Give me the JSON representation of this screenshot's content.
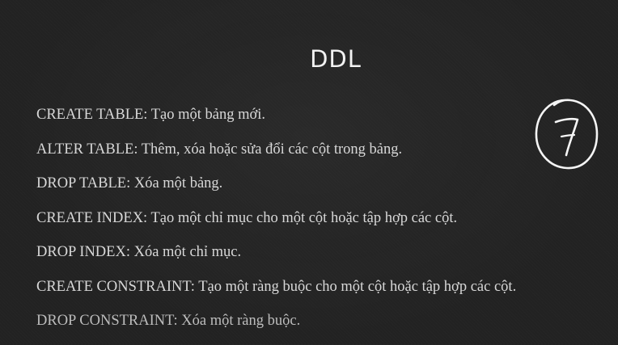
{
  "slide": {
    "title": "DDL",
    "lines": [
      "CREATE TABLE: Tạo một bảng mới.",
      "ALTER TABLE: Thêm, xóa hoặc sửa đổi các cột trong bảng.",
      "DROP TABLE: Xóa một bảng.",
      "CREATE INDEX: Tạo một chỉ mục cho một cột hoặc tập hợp các cột.",
      "DROP INDEX: Xóa một chỉ mục.",
      "CREATE CONSTRAINT: Tạo một ràng buộc cho một cột hoặc tập hợp các cột.",
      "DROP CONSTRAINT: Xóa một ràng buộc."
    ],
    "annotation": {
      "text": "7",
      "style": "handwritten number in circle",
      "color": "#f5f5f5"
    },
    "colors": {
      "background": "#222222",
      "title": "#f2f2f2",
      "text": "#d8d8d8"
    }
  }
}
